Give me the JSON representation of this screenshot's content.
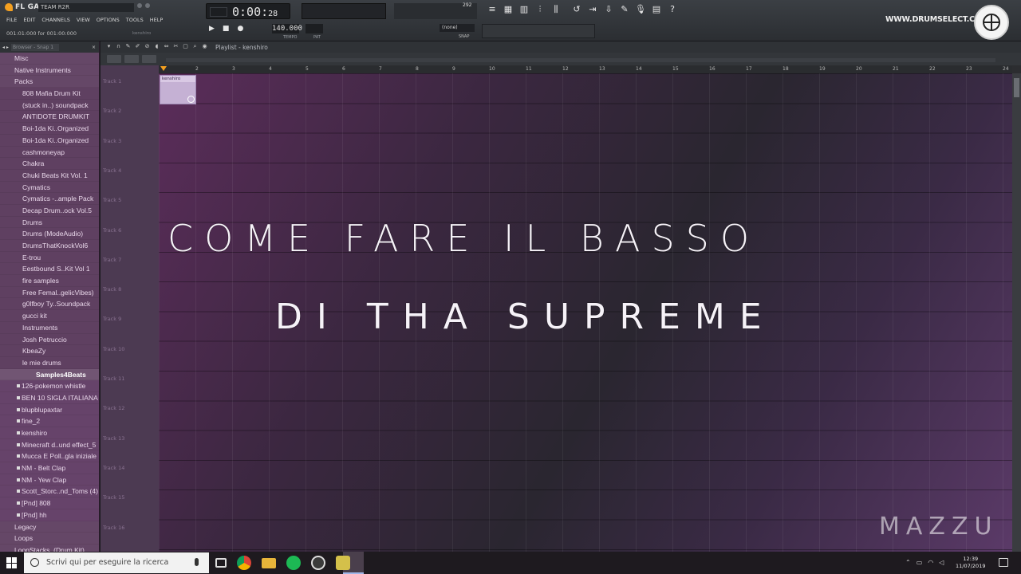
{
  "app": {
    "logo_text": "FL GANG",
    "project_name": "TEAM R2R",
    "menu": [
      "FILE",
      "EDIT",
      "CHANNELS",
      "VIEW",
      "OPTIONS",
      "TOOLS",
      "HELP"
    ],
    "hint": "001:01:000 for 001:00:000",
    "hint_right": "kenshiro",
    "time": "0:00",
    "time_small": "28",
    "tempo": "140.000",
    "tempo_label": "TEMPO",
    "pat_label": "PAT",
    "snap_value": "(none)",
    "snap_label": "SNAP",
    "cpu_value": "292",
    "website": "WWW.DRUMSELECT.COM"
  },
  "browser": {
    "header_label": "Browser - Snap 1",
    "items": [
      {
        "label": "Misc",
        "kind": "top"
      },
      {
        "label": "Native Instruments",
        "kind": "top"
      },
      {
        "label": "Packs",
        "kind": "top"
      },
      {
        "label": "808 Mafia Drum Kit",
        "kind": "folder"
      },
      {
        "label": "(stuck in..) soundpack",
        "kind": "folder"
      },
      {
        "label": "ANTIDOTE DRUMKIT",
        "kind": "folder"
      },
      {
        "label": "Boi-1da Ki..Organized",
        "kind": "folder"
      },
      {
        "label": "Boi-1da Ki..Organized",
        "kind": "folder"
      },
      {
        "label": "cashmoneyap",
        "kind": "folder"
      },
      {
        "label": "Chakra",
        "kind": "folder"
      },
      {
        "label": "Chuki Beats Kit Vol. 1",
        "kind": "folder"
      },
      {
        "label": "Cymatics",
        "kind": "folder"
      },
      {
        "label": "Cymatics -..ample Pack",
        "kind": "folder"
      },
      {
        "label": "Decap Drum..ock Vol.5",
        "kind": "folder"
      },
      {
        "label": "Drums",
        "kind": "folder"
      },
      {
        "label": "Drums (ModeAudio)",
        "kind": "folder"
      },
      {
        "label": "DrumsThatKnockVol6",
        "kind": "folder"
      },
      {
        "label": "E-trou",
        "kind": "folder"
      },
      {
        "label": "Eestbound S..Kit Vol 1",
        "kind": "folder"
      },
      {
        "label": "fire samples",
        "kind": "folder"
      },
      {
        "label": "Free Femal..gelicVibes)",
        "kind": "folder"
      },
      {
        "label": "g0lfboy Ty..Soundpack",
        "kind": "folder"
      },
      {
        "label": "gucci kit",
        "kind": "folder"
      },
      {
        "label": "Instruments",
        "kind": "folder"
      },
      {
        "label": "Josh Petruccio",
        "kind": "folder"
      },
      {
        "label": "KbeaZy",
        "kind": "folder"
      },
      {
        "label": "le mie drums",
        "kind": "folder"
      },
      {
        "label": "Samples4Beats",
        "kind": "selected"
      },
      {
        "label": "126-pokemon whistle",
        "kind": "file"
      },
      {
        "label": "BEN 10 SIGLA ITALIANA",
        "kind": "file"
      },
      {
        "label": "blupblupaxtar",
        "kind": "file"
      },
      {
        "label": "fine_2",
        "kind": "file"
      },
      {
        "label": "kenshiro",
        "kind": "file"
      },
      {
        "label": "Minecraft d..und effect_5",
        "kind": "file"
      },
      {
        "label": "Mucca E Poll..gla iniziale",
        "kind": "file"
      },
      {
        "label": "NM - Belt Clap",
        "kind": "file"
      },
      {
        "label": "NM - Yew Clap",
        "kind": "file"
      },
      {
        "label": "Scott_Storc..nd_Toms (4)",
        "kind": "file"
      },
      {
        "label": "[Pnd] 808",
        "kind": "file"
      },
      {
        "label": "[Pnd] hh",
        "kind": "file"
      },
      {
        "label": "Legacy",
        "kind": "top"
      },
      {
        "label": "Loops",
        "kind": "top"
      },
      {
        "label": "LoopStacks..(Drum Kit)",
        "kind": "top"
      }
    ]
  },
  "playlist": {
    "title": "Playlist - kenshiro",
    "tracks": [
      "Track 1",
      "Track 2",
      "Track 3",
      "Track 4",
      "Track 5",
      "Track 6",
      "Track 7",
      "Track 8",
      "Track 9",
      "Track 10",
      "Track 11",
      "Track 12",
      "Track 13",
      "Track 14",
      "Track 15",
      "Track 16"
    ],
    "ruler": [
      "2",
      "3",
      "4",
      "5",
      "6",
      "7",
      "8",
      "9",
      "10",
      "11",
      "12",
      "13",
      "14",
      "15",
      "16",
      "17",
      "18",
      "19",
      "20",
      "21",
      "22",
      "23",
      "24"
    ],
    "clip_label": "kenshiro"
  },
  "overlay": {
    "line1": "COME FARE IL BASSO",
    "line2": "DI THA SUPREME",
    "signature": "MAZZU"
  },
  "taskbar": {
    "search_placeholder": "Scrivi qui per eseguire la ricerca",
    "time": "12:39",
    "date": "11/07/2019"
  }
}
